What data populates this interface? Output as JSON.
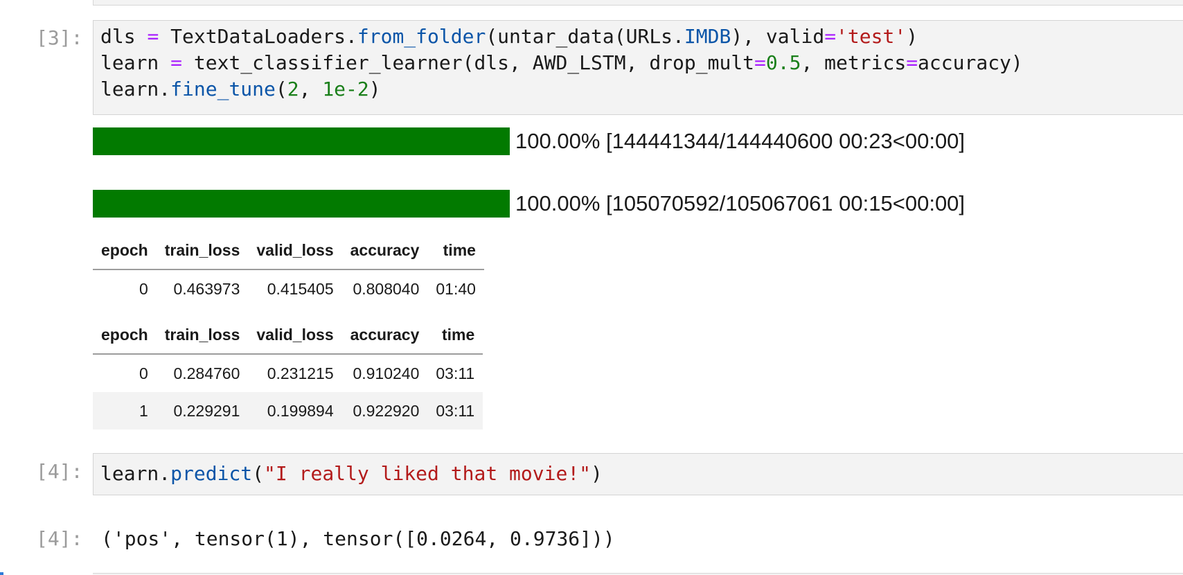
{
  "cells": [
    {
      "prompt": "[3]:",
      "code_lines": [
        [
          "dls ",
          "=",
          " TextDataLoaders.",
          "from_folder",
          "(untar_data(URLs.",
          "IMDB",
          "), valid",
          "=",
          "'test'",
          ")"
        ],
        [
          "learn ",
          "=",
          " text_classifier_learner(dls, AWD_LSTM, drop_mult",
          "=",
          "0.5",
          ", metrics",
          "=",
          "accuracy)"
        ],
        [
          "learn.",
          "fine_tune",
          "(",
          "2",
          ", ",
          "1e-2",
          ")"
        ]
      ],
      "progress": [
        {
          "fraction": 1.0,
          "text": "100.00% [144441344/144440600 00:23<00:00]"
        },
        {
          "fraction": 1.0,
          "text": "100.00% [105070592/105067061 00:15<00:00]"
        }
      ],
      "tables": [
        {
          "headers": [
            "epoch",
            "train_loss",
            "valid_loss",
            "accuracy",
            "time"
          ],
          "rows": [
            [
              "0",
              "0.463973",
              "0.415405",
              "0.808040",
              "01:40"
            ]
          ]
        },
        {
          "headers": [
            "epoch",
            "train_loss",
            "valid_loss",
            "accuracy",
            "time"
          ],
          "rows": [
            [
              "0",
              "0.284760",
              "0.231215",
              "0.910240",
              "03:11"
            ],
            [
              "1",
              "0.229291",
              "0.199894",
              "0.922920",
              "03:11"
            ]
          ]
        }
      ]
    },
    {
      "prompt": "[4]:",
      "code_lines": [
        [
          "learn.",
          "predict",
          "(",
          "\"I really liked that movie!\"",
          ")"
        ]
      ],
      "output_prompt": "[4]:",
      "output": "('pos', tensor(1), tensor([0.0264, 0.9736]))"
    }
  ],
  "colors": {
    "keyword_op": "#aa22ff",
    "function": "#0b55a8",
    "string": "#b31b1b",
    "number": "#1a7f1a",
    "progress_fill": "#027a00"
  }
}
